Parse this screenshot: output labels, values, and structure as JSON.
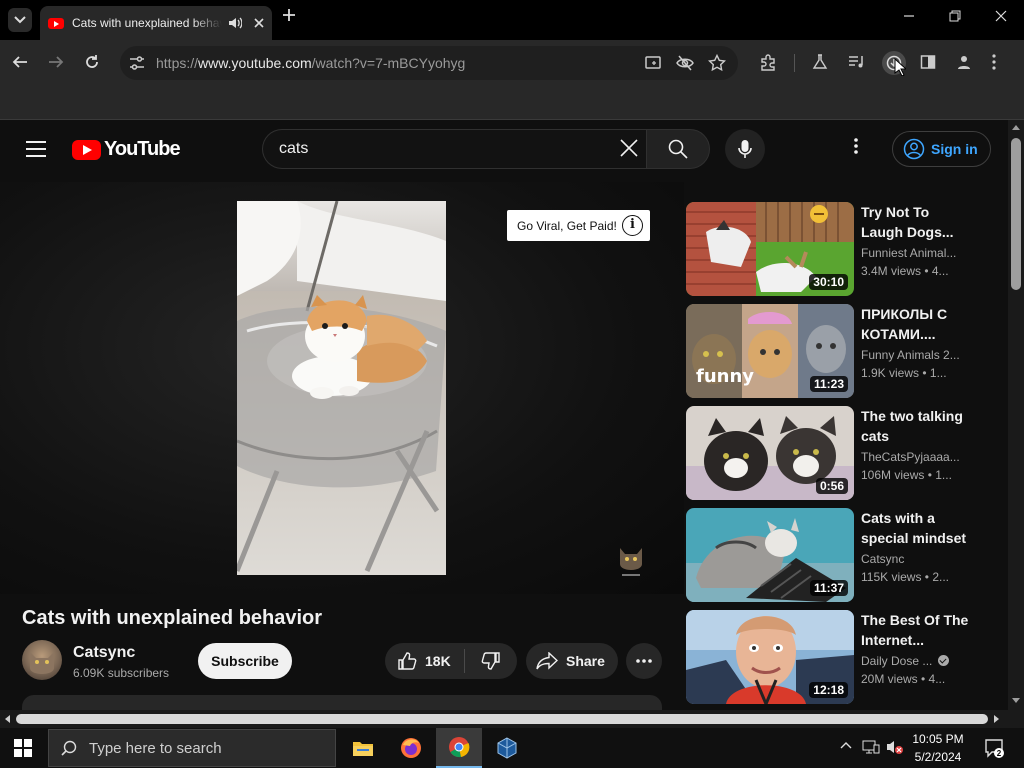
{
  "browser": {
    "tab_title": "Cats with unexplained behavior",
    "url_scheme": "https://",
    "url_host": "www.youtube.com",
    "url_path": "/watch?v=7-mBCYyohyg"
  },
  "youtube": {
    "logo_text": "YouTube",
    "search_query": "cats",
    "signin_label": "Sign in",
    "ad_overlay_text": "Go Viral, Get Paid!",
    "ad_info_glyph": "i",
    "video_title": "Cats with unexplained behavior",
    "channel_name": "Catsync",
    "channel_subs": "6.09K subscribers",
    "subscribe_label": "Subscribe",
    "like_count": "18K",
    "share_label": "Share"
  },
  "recommendations": [
    {
      "title": "Try Not To Laugh Dogs...",
      "channel": "Funniest Animal...",
      "meta": "3.4M views  •  4...",
      "duration": "30:10",
      "verified": false
    },
    {
      "title": "ПРИКОЛЫ С КОТАМИ....",
      "channel": "Funny Animals 2...",
      "meta": "1.9K views  •  1...",
      "duration": "11:23",
      "verified": false,
      "thumb_text": "funny"
    },
    {
      "title": "The two talking cats",
      "channel": "TheCatsPyjaaaa...",
      "meta": "106M views  •  1...",
      "duration": "0:56",
      "verified": false
    },
    {
      "title": "Cats with a special mindset",
      "channel": "Catsync",
      "meta": "115K views  •  2...",
      "duration": "11:37",
      "verified": false
    },
    {
      "title": "The Best Of The Internet...",
      "channel": "Daily Dose ...",
      "meta": "20M views  •  4...",
      "duration": "12:18",
      "verified": true
    }
  ],
  "taskbar": {
    "search_placeholder": "Type here to search",
    "time": "10:05 PM",
    "date": "5/2/2024"
  },
  "colors": {
    "youtube_red": "#ff0000",
    "link_blue": "#3ea6ff",
    "page_bg": "#0f0f0f"
  }
}
